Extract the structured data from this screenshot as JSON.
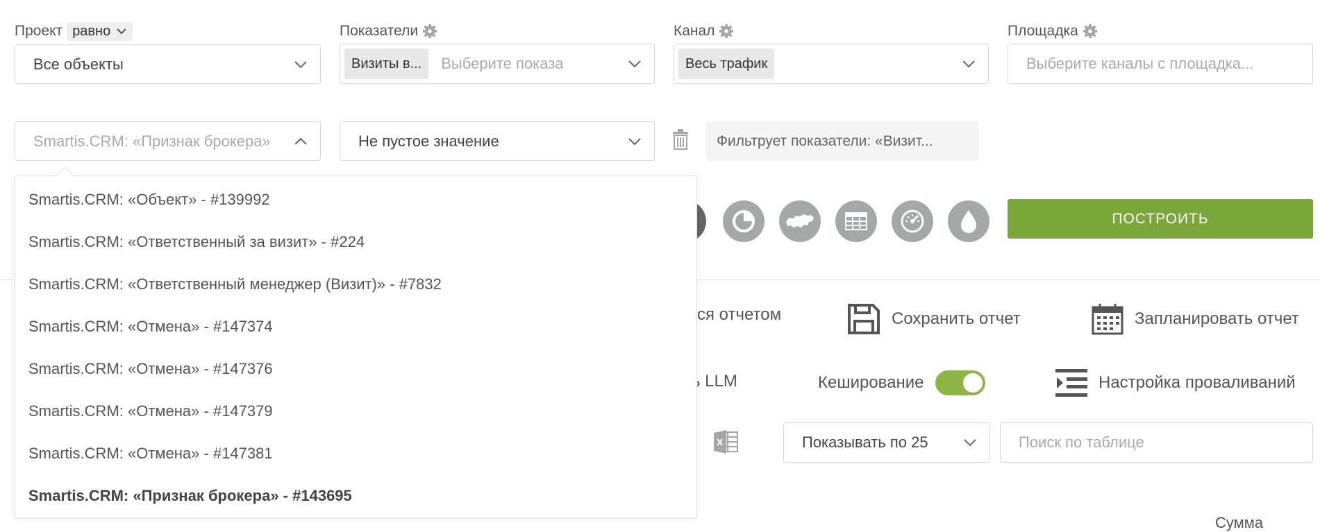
{
  "filters": {
    "project": {
      "label": "Проект",
      "operator": "равно",
      "value": "Все объекты"
    },
    "metrics": {
      "label": "Показатели",
      "tag": "Визиты в...",
      "placeholder": "Выберите показа"
    },
    "channel": {
      "label": "Канал",
      "tag": "Весь трафик"
    },
    "platform": {
      "label": "Площадка",
      "placeholder": "Выберите каналы с площадка..."
    }
  },
  "condition": {
    "field": "Smartis.CRM: «Признак брокера»",
    "operator": "Не пустое значение",
    "filter_note": "Фильтрует показатели: «Визит..."
  },
  "dropdown": {
    "items": [
      "Smartis.CRM: «Объект» - #139992",
      "Smartis.CRM: «Ответственный за визит» - #224",
      "Smartis.CRM: «Ответственный менеджер (Визит)» - #7832",
      "Smartis.CRM: «Отмена» - #147374",
      "Smartis.CRM: «Отмена» - #147376",
      "Smartis.CRM: «Отмена» - #147379",
      "Smartis.CRM: «Отмена» - #147381",
      "Smartis.CRM: «Признак брокера» - #143695"
    ]
  },
  "chart_types": [
    "pie-chart-icon",
    "russia-map-icon",
    "table-icon",
    "gauge-icon",
    "drop-icon"
  ],
  "build_button": "ПОСТРОИТЬ",
  "actions": {
    "share_partial": "ся отчетом",
    "save_report": "Сохранить отчет",
    "schedule_report": "Запланировать отчет",
    "llm_partial": "ть LLM",
    "caching": "Кеширование",
    "drilldown": "Настройка проваливаний"
  },
  "table_controls": {
    "page_size": "Показывать по 25",
    "search_placeholder": "Поиск по таблице",
    "column_partial": "Сумма"
  },
  "colors": {
    "accent_green": "#7aa63a",
    "toggle_green": "#8db548",
    "icon_gray": "#a3a8a8"
  }
}
